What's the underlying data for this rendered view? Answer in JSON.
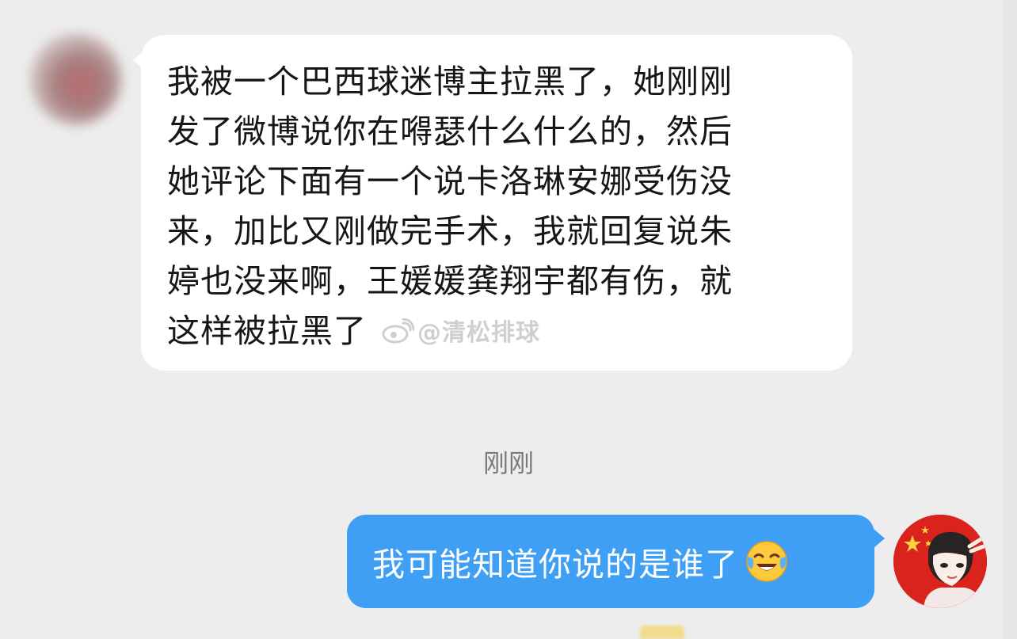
{
  "messages": [
    {
      "side": "left",
      "sender": "other",
      "text": "我被一个巴西球迷博主拉黑了，她刚刚发了微博说你在嘚瑟什么什么的，然后她评论下面有一个说卡洛琳安娜受伤没来，加比又刚做完手术，我就回复说朱婷也没来啊，王媛媛龚翔宇都有伤，就这样被拉黑了",
      "lines": [
        "我被一个巴西球迷博主拉黑了，她刚刚",
        "发了微博说你在嘚瑟什么什么的，然后",
        "她评论下面有一个说卡洛琳安娜受伤没",
        "来，加比又刚做完手术，我就回复说朱",
        "婷也没来啊，王媛媛龚翔宇都有伤，就",
        "这样被拉黑了"
      ],
      "bubble_color": "#ffffff",
      "text_color": "#161616"
    },
    {
      "side": "right",
      "sender": "me",
      "text": "我可能知道你说的是谁了",
      "emoji": "face-with-tears-of-joy-icon",
      "bubble_color": "#3e9ff5",
      "text_color": "#ffffff"
    }
  ],
  "timestamp": "刚刚",
  "watermark": {
    "text": "@清松排球",
    "icon": "weibo-logo-icon"
  },
  "colors": {
    "background": "#ededed",
    "timestamp": "#7a7a7a"
  }
}
